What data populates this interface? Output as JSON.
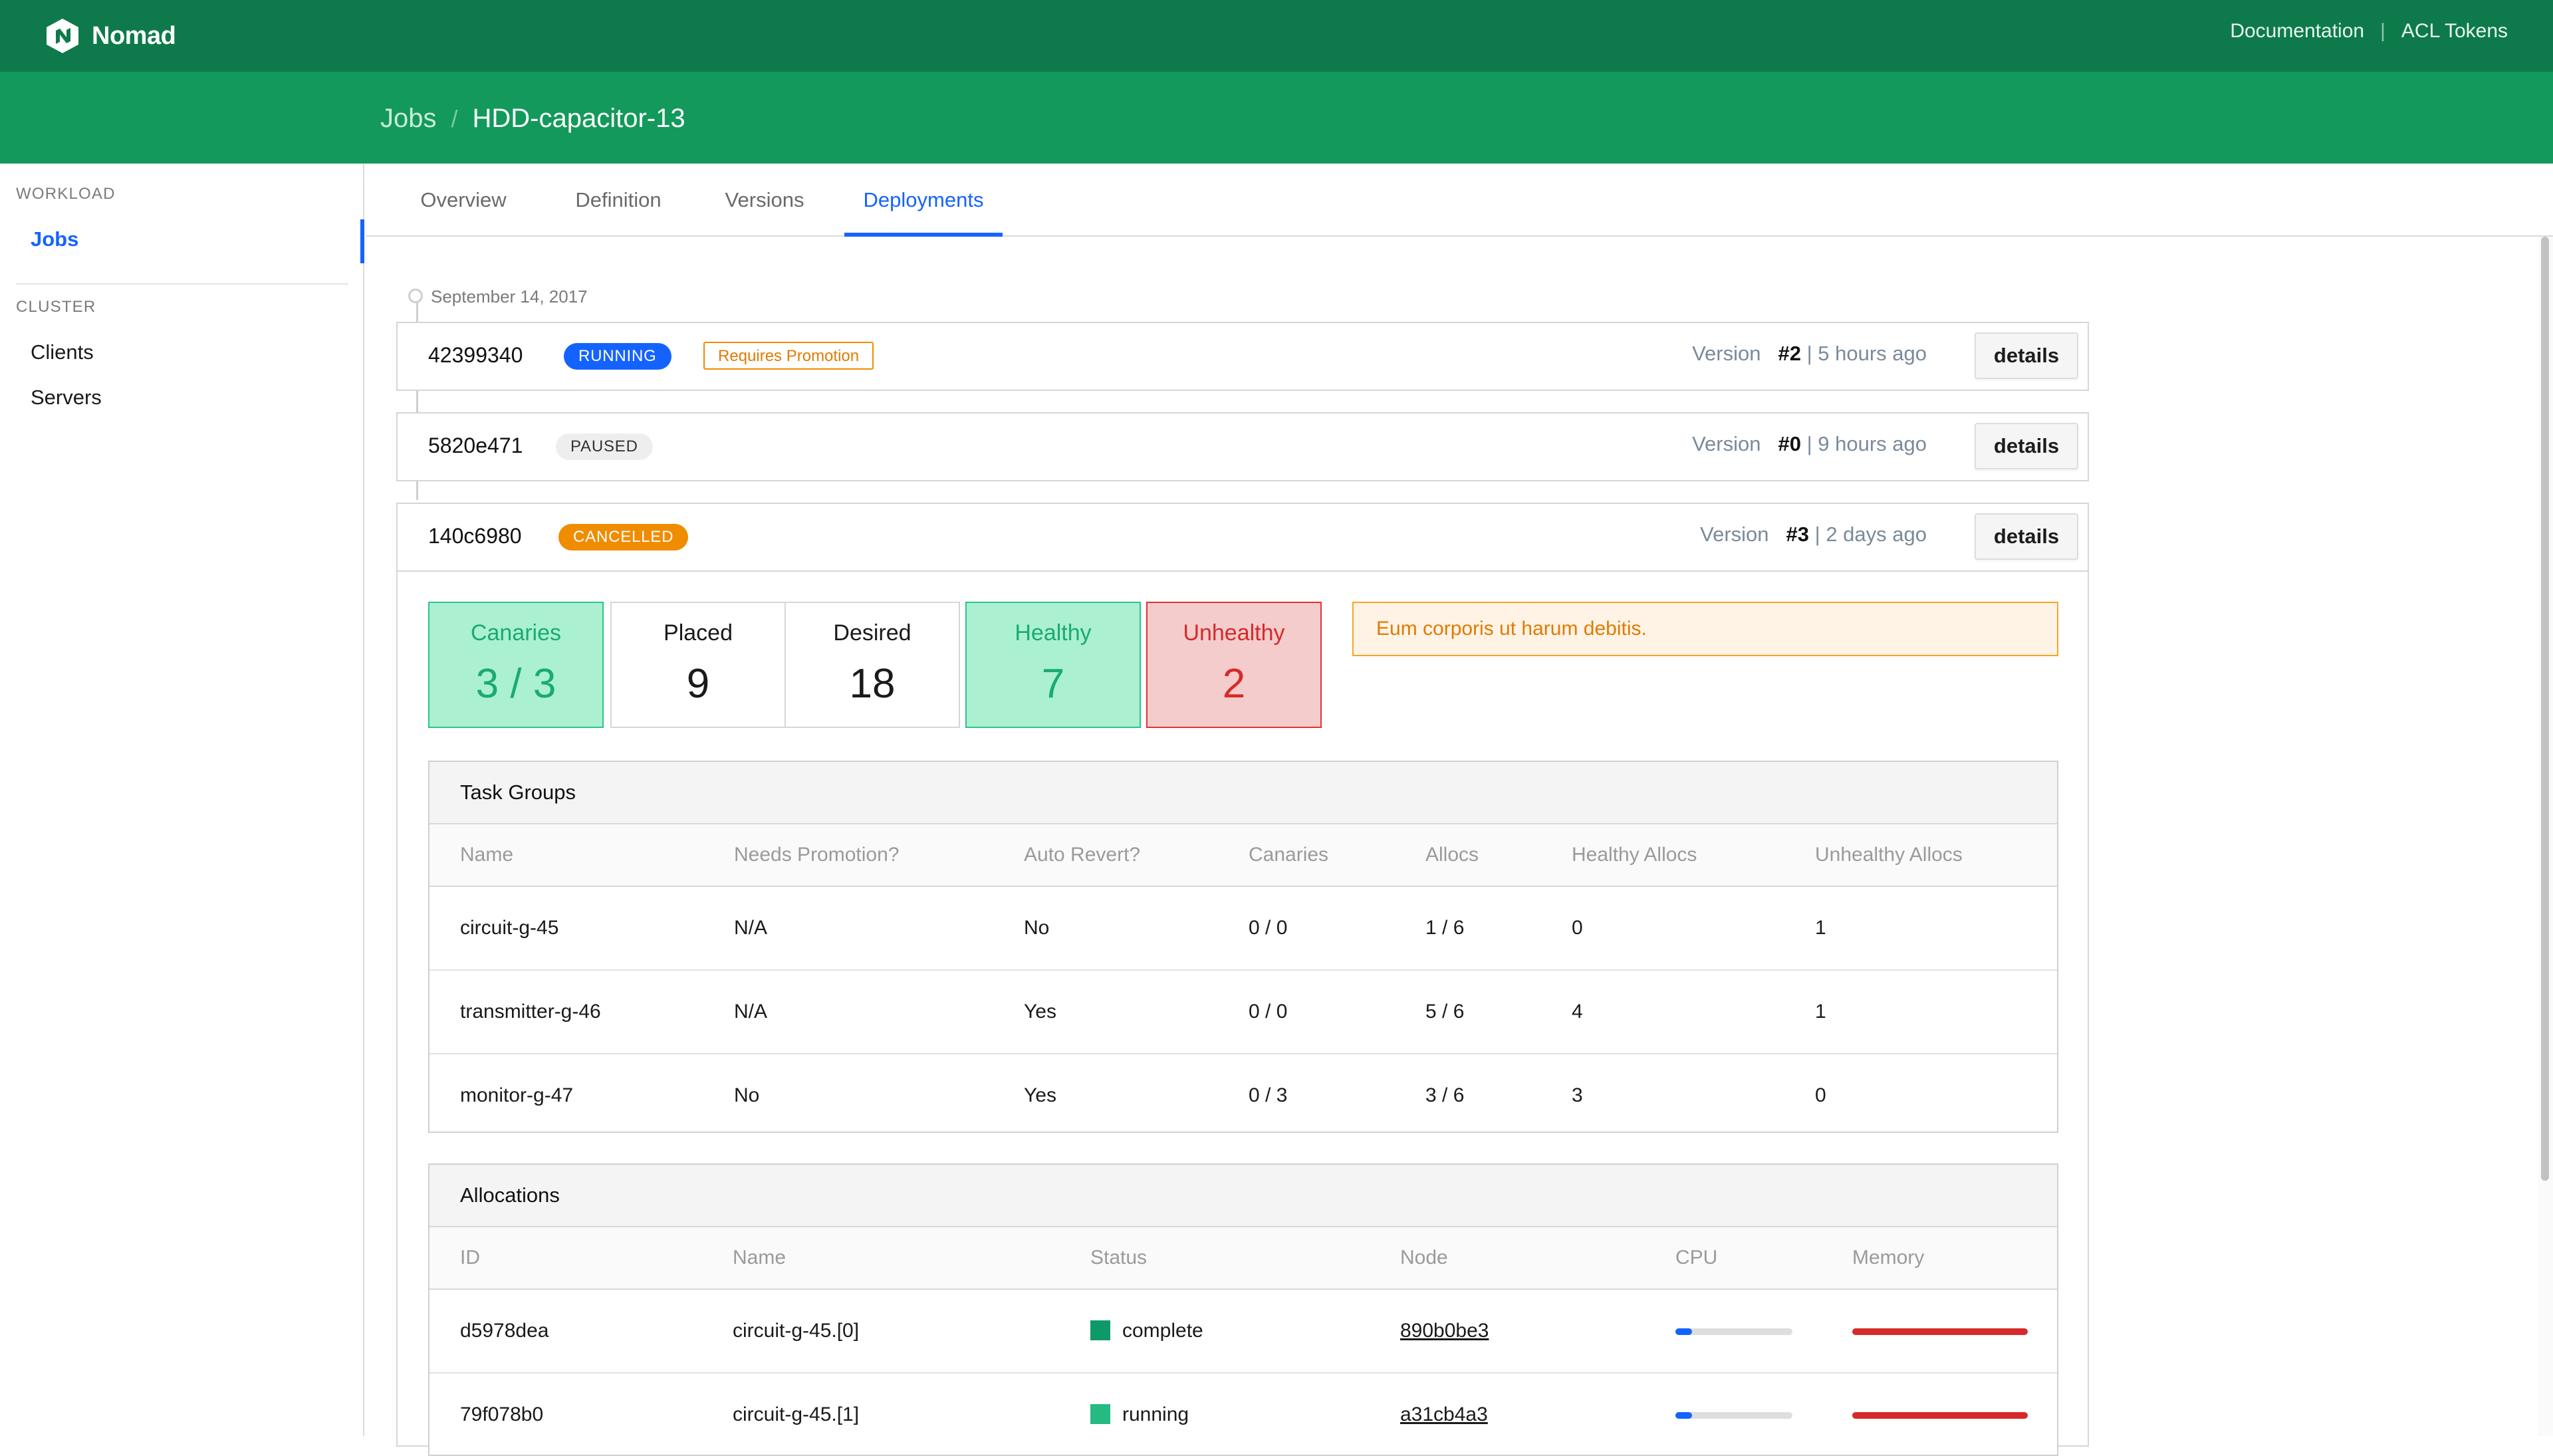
{
  "colors": {
    "topbar": "#0e7a4b",
    "subbar": "#13995b",
    "accent": "#1563ff",
    "good": "#2ec48a",
    "bad": "#e03434",
    "warning": "#f08c00"
  },
  "app": {
    "name": "Nomad",
    "logo_icon": "nomad-logo-icon"
  },
  "topnav": {
    "documentation": "Documentation",
    "separator": "|",
    "acl_tokens": "ACL Tokens"
  },
  "breadcrumb": {
    "root": "Jobs",
    "separator": "/",
    "current": "HDD-capacitor-13"
  },
  "sidebar": {
    "workload_label": "WORKLOAD",
    "jobs": "Jobs",
    "cluster_label": "CLUSTER",
    "clients": "Clients",
    "servers": "Servers"
  },
  "tabs": [
    "Overview",
    "Definition",
    "Versions",
    "Deployments"
  ],
  "active_tab": "Deployments",
  "timeline": {
    "date": "September 14, 2017"
  },
  "deployments": [
    {
      "id": "42399340",
      "status": "RUNNING",
      "promotion_tag": "Requires Promotion",
      "version_label": "Version",
      "version_number": "#2",
      "age": "| 5 hours ago",
      "details_label": "details"
    },
    {
      "id": "5820e471",
      "status": "PAUSED",
      "version_label": "Version",
      "version_number": "#0",
      "age": "| 9 hours ago",
      "details_label": "details"
    },
    {
      "id": "140c6980",
      "status": "CANCELLED",
      "version_label": "Version",
      "version_number": "#3",
      "age": "| 2 days ago",
      "details_label": "details"
    }
  ],
  "metrics": {
    "canaries": {
      "label": "Canaries",
      "value": "3 / 3"
    },
    "placed": {
      "label": "Placed",
      "value": "9"
    },
    "desired": {
      "label": "Desired",
      "value": "18"
    },
    "healthy": {
      "label": "Healthy",
      "value": "7"
    },
    "unhealthy": {
      "label": "Unhealthy",
      "value": "2"
    }
  },
  "notice": "Eum corporis ut harum debitis.",
  "task_groups": {
    "title": "Task Groups",
    "columns": [
      "Name",
      "Needs Promotion?",
      "Auto Revert?",
      "Canaries",
      "Allocs",
      "Healthy Allocs",
      "Unhealthy Allocs"
    ],
    "rows": [
      [
        "circuit-g-45",
        "N/A",
        "No",
        "0 / 0",
        "1 / 6",
        "0",
        "1"
      ],
      [
        "transmitter-g-46",
        "N/A",
        "Yes",
        "0 / 0",
        "5 / 6",
        "4",
        "1"
      ],
      [
        "monitor-g-47",
        "No",
        "Yes",
        "0 / 3",
        "3 / 6",
        "3",
        "0"
      ]
    ]
  },
  "allocations": {
    "title": "Allocations",
    "columns": [
      "ID",
      "Name",
      "Status",
      "Node",
      "CPU",
      "Memory"
    ],
    "rows": [
      {
        "id": "d5978dea",
        "name": "circuit-g-45.[0]",
        "status": "complete",
        "status_color": "#0e9a68",
        "node": "890b0be3",
        "cpu_fraction": 0.14,
        "memory_fraction": 1.0
      },
      {
        "id": "79f078b0",
        "name": "circuit-g-45.[1]",
        "status": "running",
        "status_color": "#25ba81",
        "node": "a31cb4a3",
        "cpu_fraction": 0.14,
        "memory_fraction": 1.0
      }
    ]
  }
}
